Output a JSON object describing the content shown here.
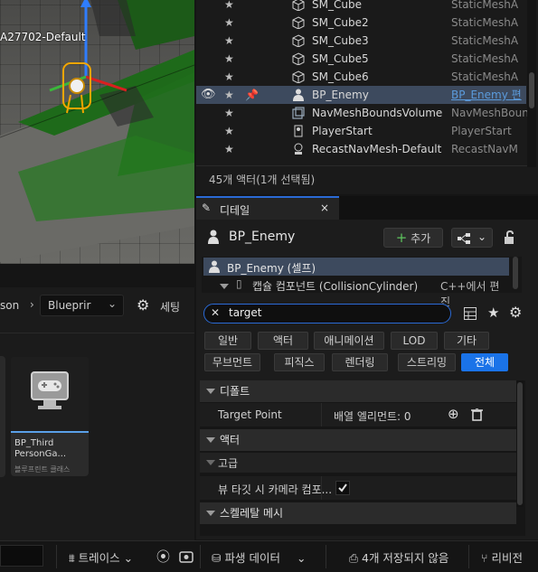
{
  "viewport": {
    "actor_label": "A27702-Default"
  },
  "outliner": {
    "rows": [
      {
        "name": "SM_Cube",
        "type": "StaticMeshA",
        "icon": "static-mesh-icon",
        "selected": false
      },
      {
        "name": "SM_Cube2",
        "type": "StaticMeshA",
        "icon": "static-mesh-icon",
        "selected": false
      },
      {
        "name": "SM_Cube3",
        "type": "StaticMeshA",
        "icon": "static-mesh-icon",
        "selected": false
      },
      {
        "name": "SM_Cube5",
        "type": "StaticMeshA",
        "icon": "static-mesh-icon",
        "selected": false
      },
      {
        "name": "SM_Cube6",
        "type": "StaticMeshA",
        "icon": "static-mesh-icon",
        "selected": false
      },
      {
        "name": "BP_Enemy",
        "type": "BP_Enemy 편",
        "icon": "pawn-icon",
        "selected": true
      },
      {
        "name": "NavMeshBoundsVolume",
        "type": "NavMeshBoun",
        "icon": "volume-icon",
        "selected": false
      },
      {
        "name": "PlayerStart",
        "type": "PlayerStart",
        "icon": "player-start-icon",
        "selected": false
      },
      {
        "name": "RecastNavMesh-Default",
        "type": "RecastNavM",
        "icon": "navmesh-icon",
        "selected": false
      }
    ],
    "status": "45개 액터(1개 선택됨)"
  },
  "details": {
    "tab_label": "디테일",
    "close_glyph": "×",
    "actor_name": "BP_Enemy",
    "add_label": "추가",
    "add_glyph": "+",
    "components": {
      "self_label": "BP_Enemy (셀프)",
      "child_label": "캡슐 컴포넌트 (CollisionCylinder)",
      "child_note": "C++에서 편진"
    },
    "search": {
      "value": "target",
      "clear_glyph": "✕"
    },
    "filters_row1": [
      "일반",
      "액터",
      "애니메이션",
      "LOD",
      "기타"
    ],
    "filters_row2": [
      "무브먼트",
      "피직스",
      "렌더링",
      "스트리밍",
      "전체"
    ],
    "active_filter": "전체",
    "sections": {
      "default": "디폴트",
      "actor": "액터",
      "advanced": "고급",
      "skeletal_mesh": "스켈레탈 메시"
    },
    "properties": {
      "target_point_label": "Target Point",
      "target_point_value": "배열 엘리먼트: 0",
      "view_target_label": "뷰 타깃 시 카메라 컴포...",
      "view_target_checked": true
    }
  },
  "content_browser": {
    "path_start": "son",
    "path_folder": "Blueprir",
    "settings_label": "세팅",
    "asset_name_line1": "BP_Third",
    "asset_name_line2": "PersonGa...",
    "asset_type": "블루프린트 클래스"
  },
  "bottom_bar": {
    "trace_label": "트레이스",
    "derived_data_label": "파생 데이터",
    "unsaved_label": "4개 저장되지 않음",
    "revision_label": "리비전"
  },
  "colors": {
    "accent_blue": "#1a73e8",
    "selection_row": "#3d4a5e",
    "add_plus_green": "#5ec45e"
  }
}
